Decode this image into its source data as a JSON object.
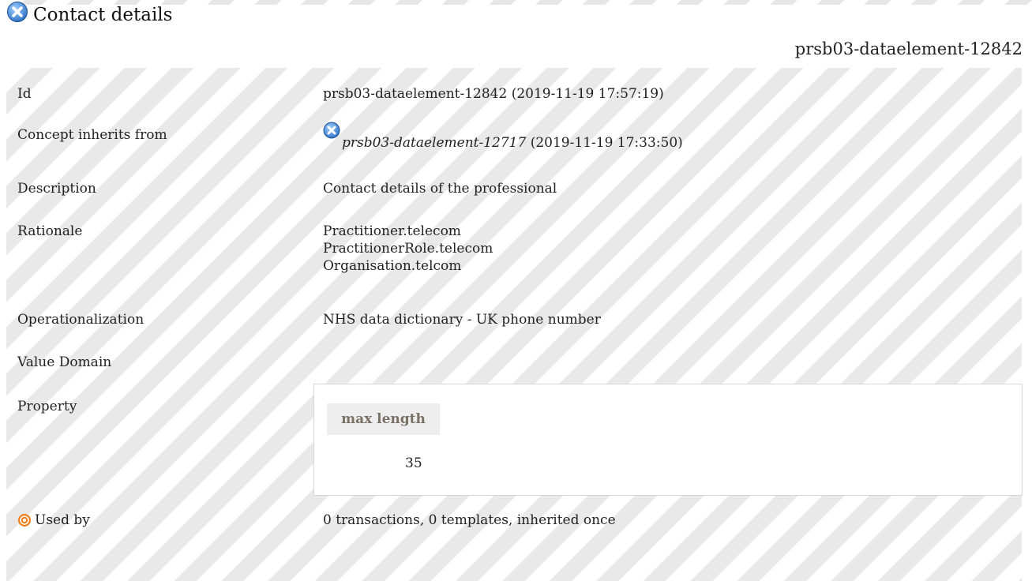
{
  "header": {
    "title": "Contact details",
    "concept_id": "prsb03-dataelement-12842",
    "icon": "blue-x-circle-icon"
  },
  "rows": {
    "id": {
      "label": "Id",
      "value": "prsb03-dataelement-12842 (2019-11-19 17:57:19)"
    },
    "inherits": {
      "label": "Concept inherits from",
      "ref_id": "prsb03-dataelement-12717",
      "ref_date": " (2019-11-19 17:33:50)"
    },
    "description": {
      "label": "Description",
      "value": "Contact details of the professional"
    },
    "rationale": {
      "label": "Rationale",
      "lines": [
        "Practitioner.telecom",
        "PractitionerRole.telecom",
        "Organisation.telcom"
      ]
    },
    "operationalization": {
      "label": "Operationalization",
      "value": "NHS data dictionary - UK phone number"
    },
    "value_domain": {
      "label": "Value Domain"
    },
    "property": {
      "label": "Property",
      "column_header": "max length",
      "cell_value": "35"
    },
    "used_by": {
      "label": "Used by",
      "value": "0 transactions, 0 templates, inherited once",
      "icon": "orange-target-icon"
    }
  },
  "colors": {
    "x_icon_blue": "#4a8fd9",
    "target_orange": "#f07f1a",
    "header_cell_text": "#7a7166"
  }
}
